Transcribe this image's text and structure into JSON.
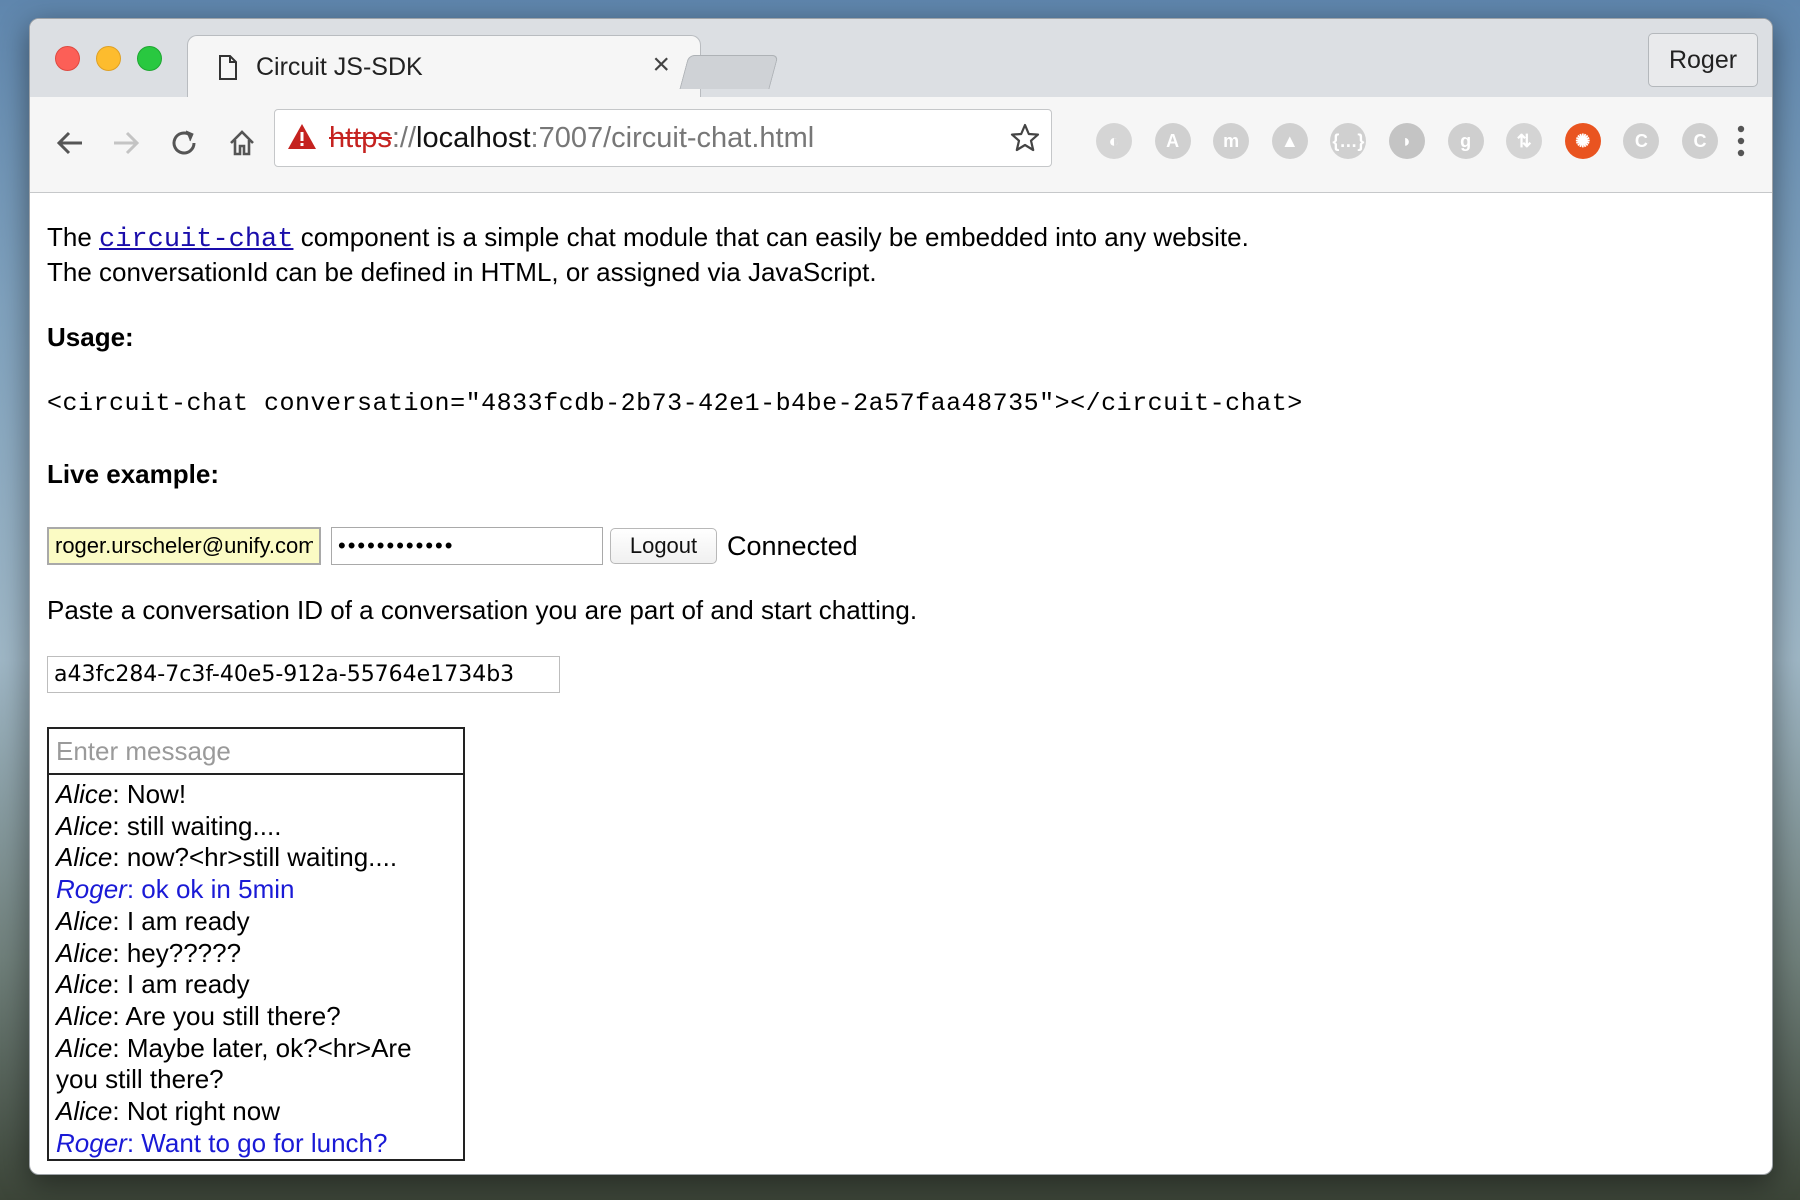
{
  "browser": {
    "tab_title": "Circuit JS-SDK",
    "tab_close": "×",
    "profile_name": "Roger",
    "url": {
      "scheme": "https",
      "separator": "://",
      "host": "localhost",
      "rest": ":7007/circuit-chat.html"
    },
    "extensions": [
      {
        "name": "extension-1-icon",
        "glyph": "◐",
        "color": "#d5d5d5"
      },
      {
        "name": "angular-extension-icon",
        "glyph": "A",
        "color": "#d0d0d0"
      },
      {
        "name": "m-extension-icon",
        "glyph": "m",
        "color": "#d0d0d0"
      },
      {
        "name": "drive-extension-icon",
        "glyph": "▲",
        "color": "#d0d0d0"
      },
      {
        "name": "json-extension-icon",
        "glyph": "{…}",
        "color": "#d0d0d0"
      },
      {
        "name": "extension-6-icon",
        "glyph": "◗",
        "color": "#c4c4c4"
      },
      {
        "name": "google-extension-icon",
        "glyph": "g",
        "color": "#cfcfcf"
      },
      {
        "name": "extension-8-icon",
        "glyph": "⇅",
        "color": "#d4d4d4"
      },
      {
        "name": "ubuntu-extension-icon",
        "glyph": "✺",
        "color": "#e95420"
      },
      {
        "name": "c-extension-1-icon",
        "glyph": "C",
        "color": "#cfcfcf"
      },
      {
        "name": "c-extension-2-icon",
        "glyph": "C",
        "color": "#cfcfcf"
      }
    ]
  },
  "page": {
    "intro_prefix": "The ",
    "intro_link": "circuit-chat",
    "intro_suffix": " component is a simple chat module that can easily be embedded into any website.",
    "intro_line2": "The conversationId can be defined in HTML, or assigned via JavaScript.",
    "usage_heading": "Usage:",
    "usage_code": "<circuit-chat conversation=\"4833fcdb-2b73-42e1-b4be-2a57faa48735\"></circuit-chat>",
    "live_heading": "Live example:",
    "email_value": "roger.urscheler@unify.com",
    "password_value": "••••••••••••",
    "logout_label": "Logout",
    "status_text": "Connected",
    "hint_text": "Paste a conversation ID of a conversation you are part of and start chatting.",
    "conversation_id": "a43fc284-7c3f-40e5-912a-55764e1734b3"
  },
  "chat": {
    "input_placeholder": "Enter message",
    "messages": [
      {
        "who": "Alice",
        "text": "Now!",
        "self": false
      },
      {
        "who": "Alice",
        "text": "still waiting....",
        "self": false
      },
      {
        "who": "Alice",
        "text": "now?<hr>still waiting....",
        "self": false
      },
      {
        "who": "Roger",
        "text": "ok ok in 5min",
        "self": true
      },
      {
        "who": "Alice",
        "text": "I am ready",
        "self": false
      },
      {
        "who": "Alice",
        "text": "hey?????",
        "self": false
      },
      {
        "who": "Alice",
        "text": "I am ready",
        "self": false
      },
      {
        "who": "Alice",
        "text": "Are you still there?",
        "self": false
      },
      {
        "who": "Alice",
        "text": "Maybe later, ok?<hr>Are you still there?",
        "self": false
      },
      {
        "who": "Alice",
        "text": "Not right now",
        "self": false
      },
      {
        "who": "Roger",
        "text": "Want to go for lunch?",
        "self": true
      }
    ]
  }
}
